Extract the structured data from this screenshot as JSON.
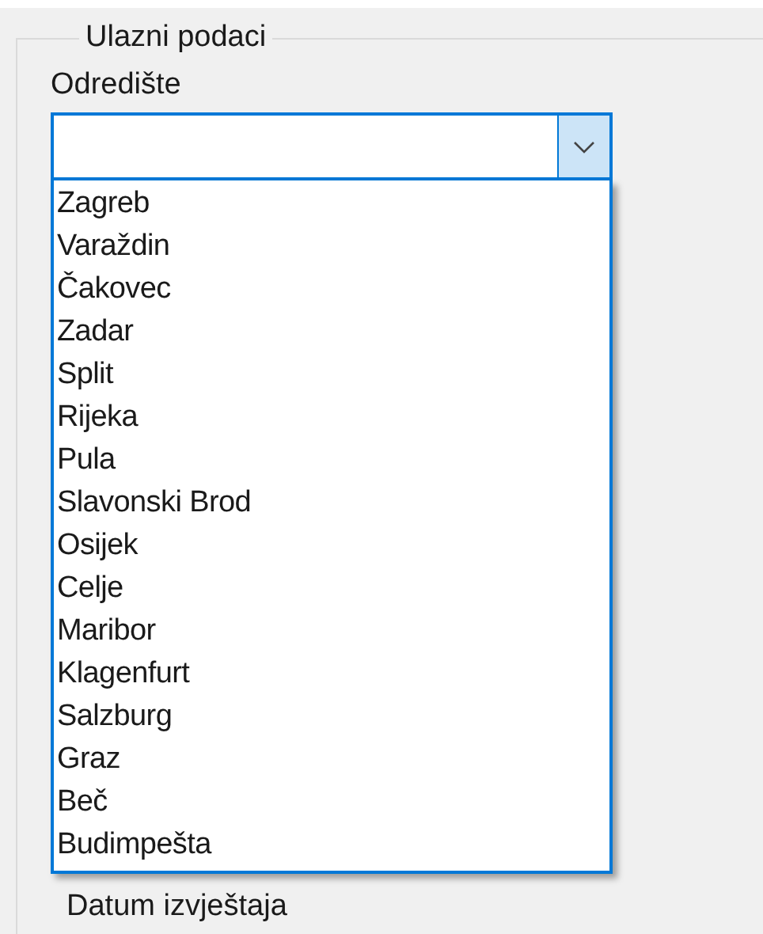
{
  "group": {
    "title": "Ulazni podaci"
  },
  "destination": {
    "label": "Odredište",
    "expanded": true,
    "options": [
      {
        "label": "Zagreb",
        "selected": false
      },
      {
        "label": "Varaždin",
        "selected": false
      },
      {
        "label": "Čakovec",
        "selected": false
      },
      {
        "label": "Zadar",
        "selected": false
      },
      {
        "label": "Split",
        "selected": false
      },
      {
        "label": "Rijeka",
        "selected": false
      },
      {
        "label": "Pula",
        "selected": false
      },
      {
        "label": "Slavonski Brod",
        "selected": false
      },
      {
        "label": "Osijek",
        "selected": false
      },
      {
        "label": "Celje",
        "selected": false
      },
      {
        "label": "Maribor",
        "selected": false
      },
      {
        "label": "Klagenfurt",
        "selected": false
      },
      {
        "label": "Salzburg",
        "selected": false
      },
      {
        "label": "Graz",
        "selected": false
      },
      {
        "label": "Beč",
        "selected": false
      },
      {
        "label": "Budimpešta",
        "selected": false
      }
    ]
  },
  "report_date": {
    "label": "Datum izvještaja"
  }
}
